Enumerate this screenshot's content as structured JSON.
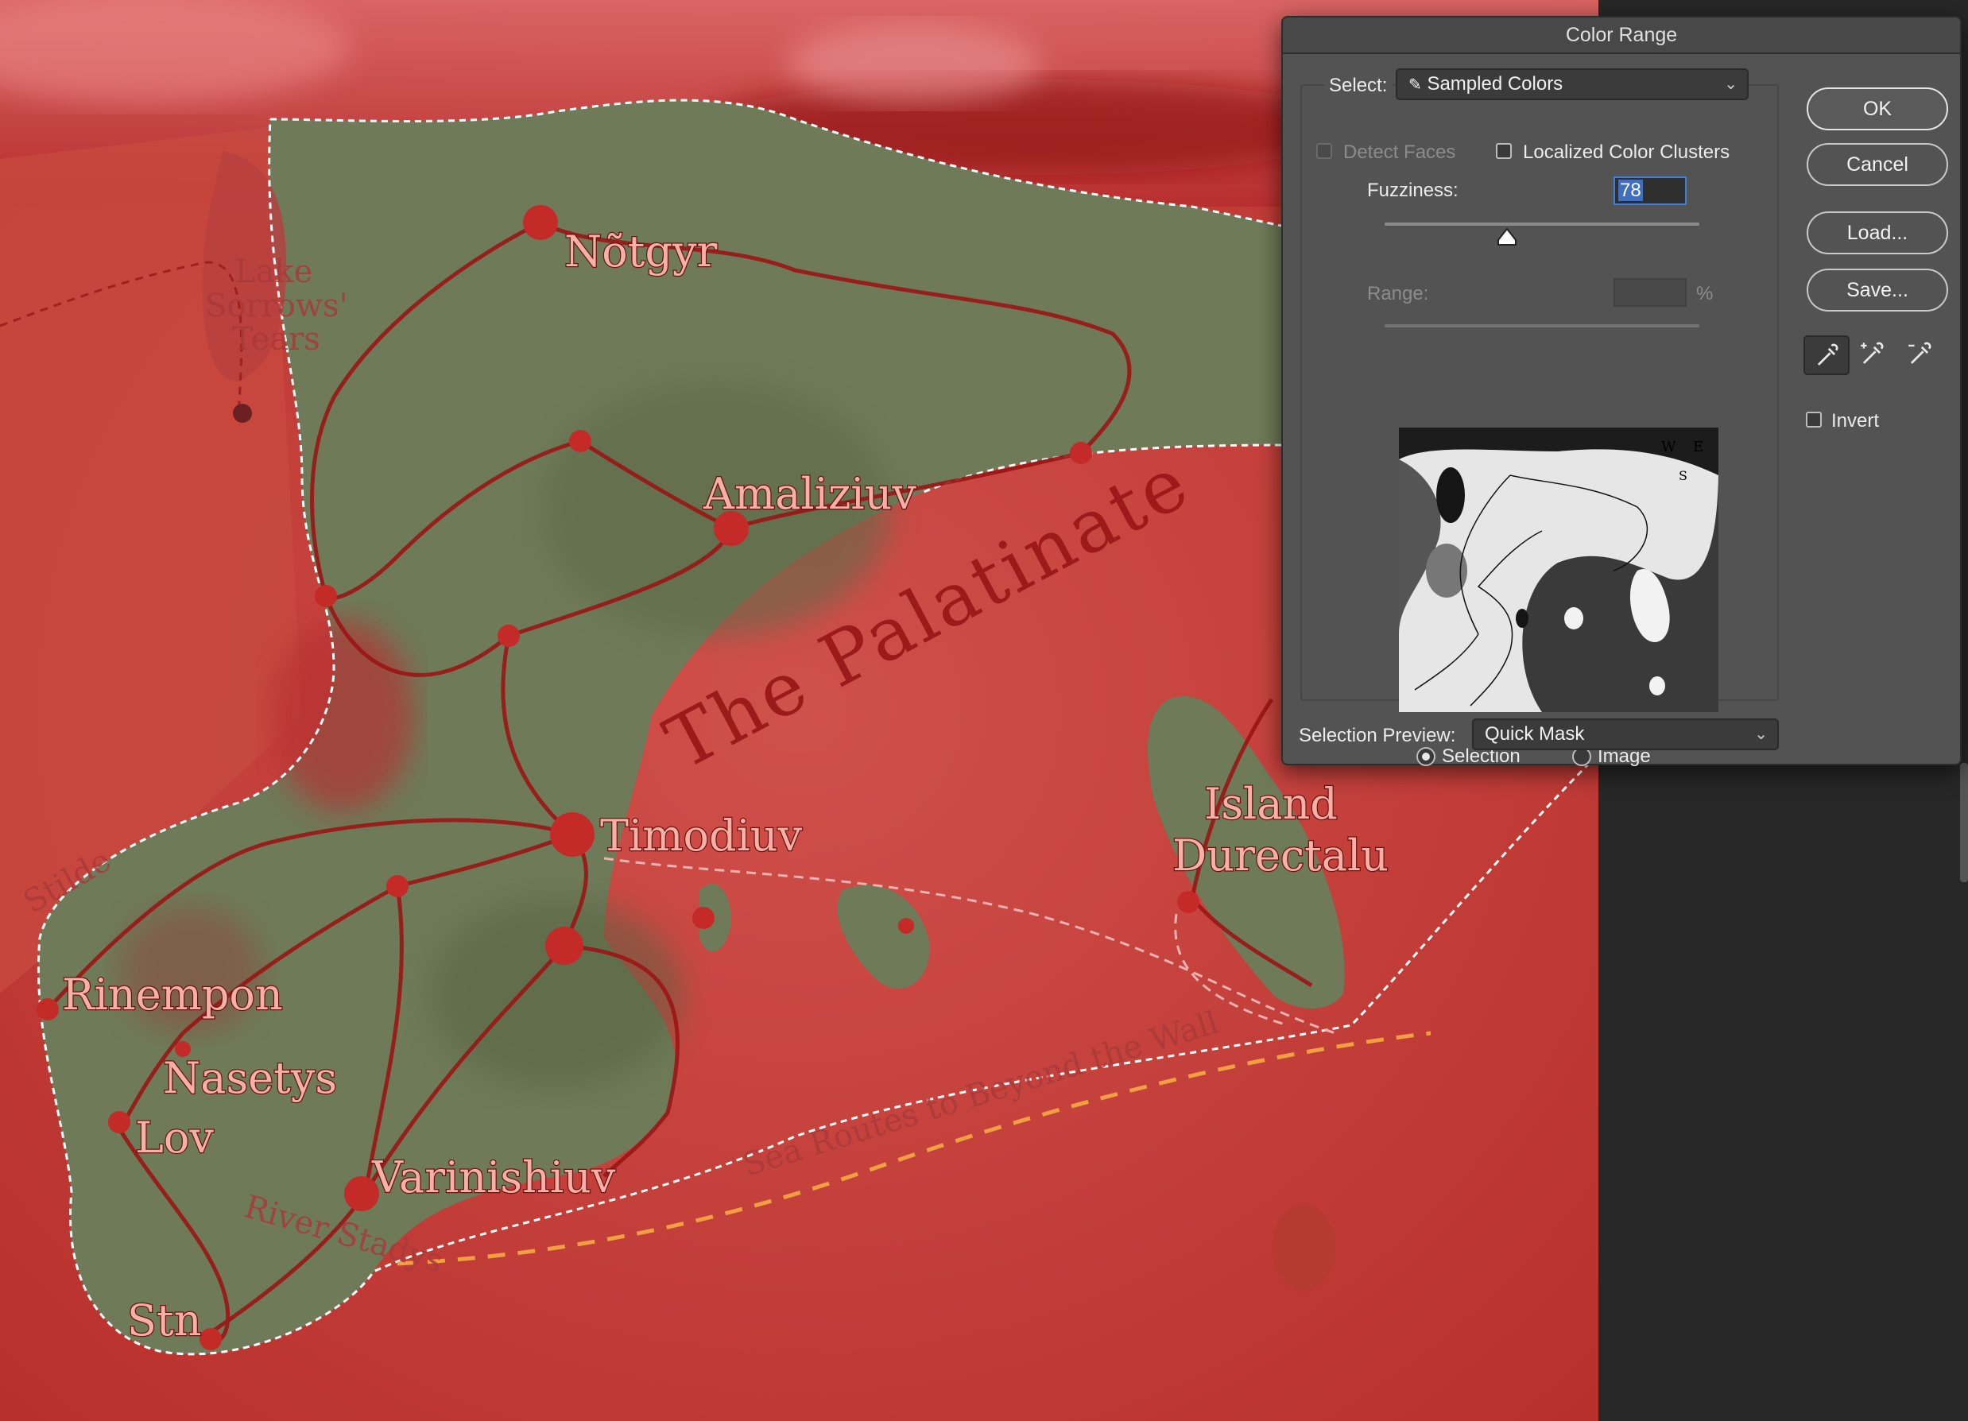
{
  "map": {
    "places": [
      {
        "name": "Nõtgyr"
      },
      {
        "name": "Amaliziuv"
      },
      {
        "name": "Timodiuv"
      },
      {
        "name": "Rinempon"
      },
      {
        "name": "Nasetys"
      },
      {
        "name": "Lov"
      },
      {
        "name": "Varinishiuv"
      },
      {
        "name": "Stn"
      },
      {
        "name": "Island"
      },
      {
        "name": "Durectalu"
      }
    ],
    "region_label": "The Palatinate",
    "lake_label": [
      "Lake",
      "Sorrows'",
      "Tears"
    ],
    "river_label": "River Stadys",
    "sea_route_label": "Sea Routes to Beyond the Wall",
    "partial_label": "Stilde"
  },
  "dialog": {
    "title": "Color Range",
    "select_label": "Select:",
    "select_value": "Sampled Colors",
    "detect_faces_label": "Detect Faces",
    "detect_faces_checked": false,
    "localized_label": "Localized Color Clusters",
    "localized_checked": false,
    "fuzziness_label": "Fuzziness:",
    "fuzziness_value": "78",
    "fuzziness_fraction": 0.39,
    "range_label": "Range:",
    "range_unit": "%",
    "range_value": "",
    "preview_mode_selection": "Selection",
    "preview_mode_image": "Image",
    "preview_mode_selected": "Selection",
    "selection_preview_label": "Selection Preview:",
    "selection_preview_value": "Quick Mask",
    "buttons": {
      "ok": "OK",
      "cancel": "Cancel",
      "load": "Load...",
      "save": "Save..."
    },
    "invert_label": "Invert",
    "invert_checked": false,
    "thumbnail_labels": [
      "W",
      "E",
      "S"
    ]
  },
  "colors": {
    "land_green": "#6e7a58",
    "map_red": "#c23a34",
    "dialog_bg": "#535353",
    "focus_blue": "#3d7fd9"
  }
}
